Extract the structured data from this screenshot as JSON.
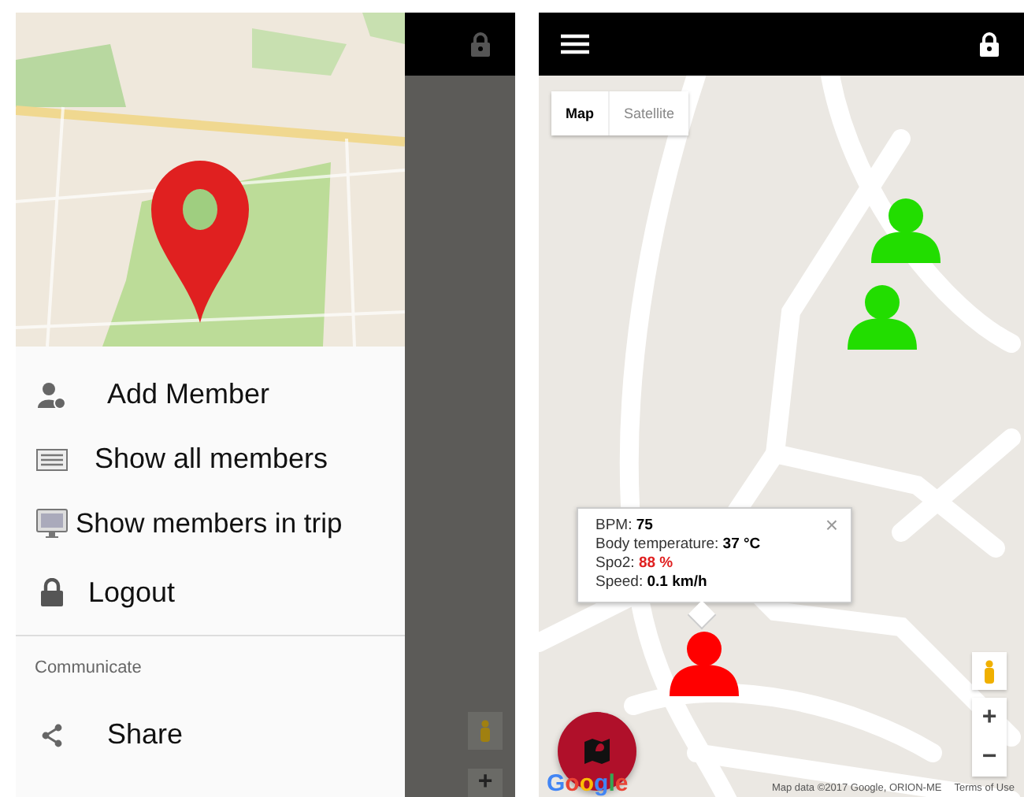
{
  "drawer_screen": {
    "menu_items": [
      {
        "label": "Add Member"
      },
      {
        "label": "Show all members"
      },
      {
        "label": "Show members in trip"
      },
      {
        "label": "Logout"
      }
    ],
    "section_title": "Communicate",
    "section_items": [
      {
        "label": "Share"
      }
    ],
    "dimmed_map": {
      "zoom_in": "+"
    }
  },
  "map_screen": {
    "map_type_tabs": [
      {
        "label": "Map",
        "selected": true
      },
      {
        "label": "Satellite",
        "selected": false
      }
    ],
    "markers": [
      {
        "color": "#22dd00"
      },
      {
        "color": "#22dd00"
      },
      {
        "color": "#ff0000"
      }
    ],
    "info_window": {
      "close": "×",
      "lines": [
        {
          "label": "BPM:",
          "value": "75",
          "alert": false
        },
        {
          "label": "Body temperature:",
          "value": "37 °C",
          "alert": false
        },
        {
          "label": "Spo2:",
          "value": "88 %",
          "alert": true
        },
        {
          "label": "Speed:",
          "value": "0.1 km/h",
          "alert": false
        }
      ]
    },
    "zoom_controls": {
      "zoom_in": "+",
      "zoom_out": "−"
    },
    "logo": "Google",
    "attribution": "Map data ©2017 Google, ORION-ME",
    "terms_link": "Terms of Use"
  }
}
